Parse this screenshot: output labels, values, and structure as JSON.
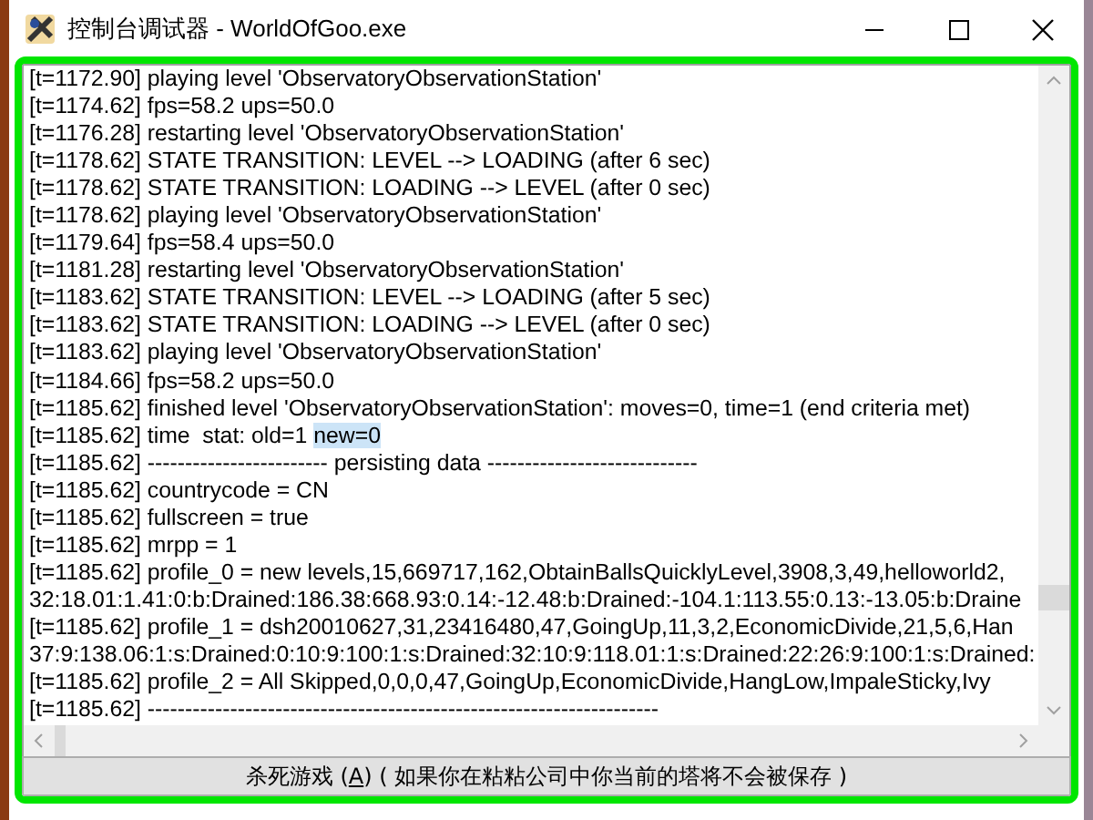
{
  "window": {
    "title": "控制台调试器 - WorldOfGoo.exe"
  },
  "log": [
    {
      "text": "[t=1172.90] playing level 'ObservatoryObservationStation'"
    },
    {
      "text": "[t=1174.62] fps=58.2 ups=50.0"
    },
    {
      "text": "[t=1176.28] restarting level 'ObservatoryObservationStation'"
    },
    {
      "text": "[t=1178.62] STATE TRANSITION: LEVEL --> LOADING (after 6 sec)"
    },
    {
      "text": "[t=1178.62] STATE TRANSITION: LOADING --> LEVEL (after 0 sec)"
    },
    {
      "text": "[t=1178.62] playing level 'ObservatoryObservationStation'"
    },
    {
      "text": "[t=1179.64] fps=58.4 ups=50.0"
    },
    {
      "text": "[t=1181.28] restarting level 'ObservatoryObservationStation'"
    },
    {
      "text": "[t=1183.62] STATE TRANSITION: LEVEL --> LOADING (after 5 sec)"
    },
    {
      "text": "[t=1183.62] STATE TRANSITION: LOADING --> LEVEL (after 0 sec)"
    },
    {
      "text": "[t=1183.62] playing level 'ObservatoryObservationStation'"
    },
    {
      "text": "[t=1184.66] fps=58.2 ups=50.0"
    },
    {
      "text": "[t=1185.62] finished level 'ObservatoryObservationStation': moves=0, time=1 (end criteria met)"
    },
    {
      "text": "[t=1185.62] time  stat: old=1 ",
      "selection": "new=0"
    },
    {
      "text": "[t=1185.62] ------------------------ persisting data ----------------------------"
    },
    {
      "text": "[t=1185.62] countrycode = CN"
    },
    {
      "text": "[t=1185.62] fullscreen = true"
    },
    {
      "text": "[t=1185.62] mrpp = 1"
    },
    {
      "text": "[t=1185.62] profile_0 = new levels,15,669717,162,ObtainBallsQuicklyLevel,3908,3,49,helloworld2,"
    },
    {
      "text": "32:18.01:1.41:0:b:Drained:186.38:668.93:0.14:-12.48:b:Drained:-104.1:113.55:0.13:-13.05:b:Draine"
    },
    {
      "text": "[t=1185.62] profile_1 = dsh20010627,31,23416480,47,GoingUp,11,3,2,EconomicDivide,21,5,6,Han"
    },
    {
      "text": "37:9:138.06:1:s:Drained:0:10:9:100:1:s:Drained:32:10:9:118.01:1:s:Drained:22:26:9:100:1:s:Drained:"
    },
    {
      "text": "[t=1185.62] profile_2 = All Skipped,0,0,0,47,GoingUp,EconomicDivide,HangLow,ImpaleSticky,Ivy"
    },
    {
      "text": "[t=1185.62] --------------------------------------------------------------------"
    }
  ],
  "button": {
    "label_parts": [
      "杀死游戏 (",
      "A",
      ") ( 如果你在粘粘公司中你当前的塔将不会被保存 )"
    ]
  }
}
